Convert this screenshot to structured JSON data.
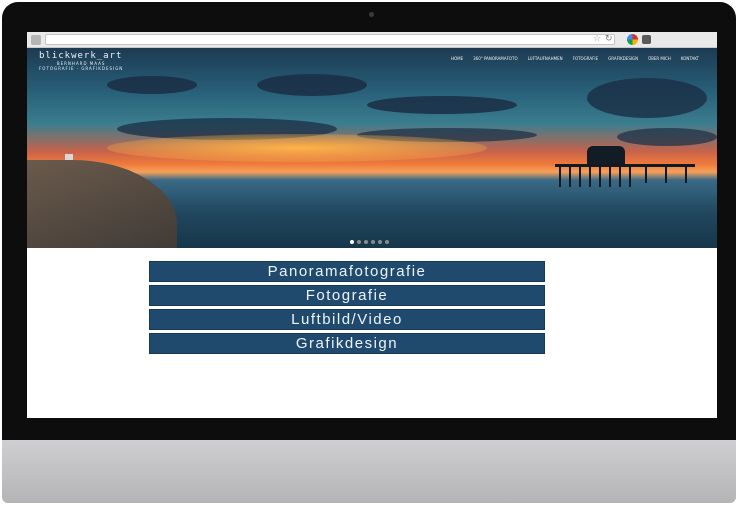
{
  "site": {
    "logo_title": "blickwerk_art",
    "logo_subtitle_1": "BERNHARD MAAS",
    "logo_subtitle_2": "FOTOGRAFIE · GRAFIKDESIGN"
  },
  "nav": {
    "items": [
      "HOME",
      "360° PANORAMAFOTO",
      "LUFTAUFNAHMEN",
      "FOTOGRAFIE",
      "GRAFIKDESIGN",
      "ÜBER MICH",
      "KONTAKT"
    ]
  },
  "menu": {
    "buttons": [
      "Panoramafotografie",
      "Fotografie",
      "Luftbild/Video",
      "Grafikdesign"
    ]
  },
  "slider": {
    "active_index": 0,
    "count": 6
  },
  "colors": {
    "button_bg": "#1f4a6e",
    "bezel": "#0d0d0d",
    "stand": "#c2c2c4"
  },
  "icons": [
    "star-icon",
    "reload-icon",
    "chrome-icon",
    "menu-icon"
  ]
}
